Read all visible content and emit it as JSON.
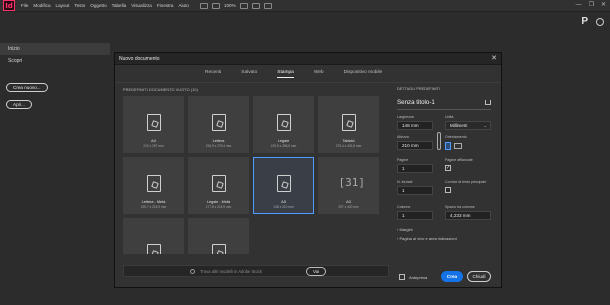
{
  "app": {
    "logo_text": "Id",
    "menu": [
      "File",
      "Modifica",
      "Layout",
      "Testo",
      "Oggetto",
      "Tabella",
      "Visualizza",
      "Finestra",
      "Aiuto"
    ],
    "zoom": "100%",
    "window_controls": [
      "—",
      "❐",
      "✕"
    ]
  },
  "left_panel": {
    "nav": [
      {
        "label": "Inizio",
        "active": true
      },
      {
        "label": "Scopri",
        "active": false
      }
    ],
    "create_button": "Crea nuovo...",
    "open_button": "Apri..."
  },
  "dialog": {
    "title": "Nuovo documento",
    "close": "✕",
    "tabs": [
      {
        "label": "Recenti",
        "active": false
      },
      {
        "label": "Salvato",
        "active": false
      },
      {
        "label": "Stampa",
        "active": true
      },
      {
        "label": "Web",
        "active": false
      },
      {
        "label": "Dispositivo mobile",
        "active": false
      }
    ],
    "presets_label": "PREDEFINITI DOCUMENTO VUOTO (10)",
    "presets": [
      {
        "name": "A4",
        "dim": "210 x 297 mm",
        "selected": false
      },
      {
        "name": "Lettera",
        "dim": "215,9 x 279,4 mm",
        "selected": false
      },
      {
        "name": "Legale",
        "dim": "215,9 x 355,6 mm",
        "selected": false
      },
      {
        "name": "Tabloid",
        "dim": "279,4 x 431,8 mm",
        "selected": false
      },
      {
        "name": "Lettera - Metà",
        "dim": "139,7 x 215,9 mm",
        "selected": false
      },
      {
        "name": "Legale - Metà",
        "dim": "177,8 x 215,9 mm",
        "selected": false
      },
      {
        "name": "A5",
        "dim": "148 x 210 mm",
        "selected": true
      },
      {
        "name": "A3",
        "dim": "297 x 420 mm",
        "selected": false,
        "bracket": "[31]"
      },
      {
        "name": "",
        "dim": "",
        "selected": false
      },
      {
        "name": "",
        "dim": "",
        "selected": false
      }
    ],
    "search_placeholder": "Trova altri modelli in Adobe Stock",
    "search_button": "Vai",
    "details": {
      "header": "DETTAGLI PREDEFINITI",
      "doc_name": "Senza titolo-1",
      "width_label": "Larghezza",
      "width_value": "148 mm",
      "units_label": "Unità",
      "units_value": "Millimetri",
      "height_label": "Altezza",
      "height_value": "210 mm",
      "orientation_label": "Orientamento",
      "pages_label": "Pagine",
      "pages_value": "1",
      "facing_label": "Pagine affiancate",
      "facing_checked": "✓",
      "start_label": "N. iniziale",
      "start_value": "1",
      "primary_frame_label": "Cornice di testo principale",
      "columns_label": "Colonne",
      "columns_value": "1",
      "gutter_label": "Spazio tra colonne",
      "gutter_value": "4,233 mm",
      "margins_label": "Margini",
      "bleed_label": "Pagina al vivo e area indicazioni"
    },
    "preview_label": "Anteprima",
    "create_button": "Crea",
    "close_button": "Chiudi"
  }
}
